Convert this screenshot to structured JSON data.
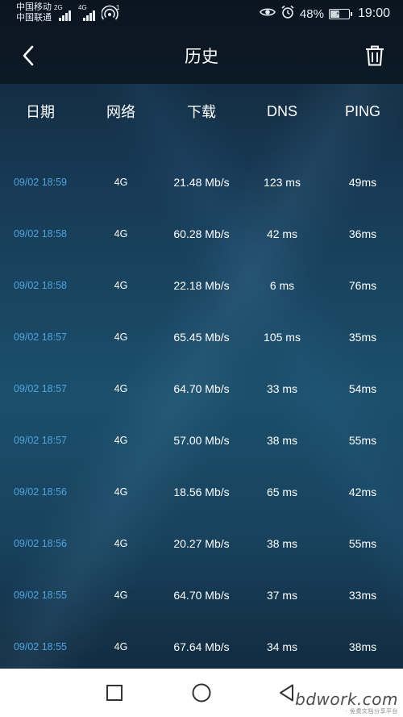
{
  "status_bar": {
    "carrier_1": "中国移动",
    "carrier_2": "中国联通",
    "network_1": "2G",
    "network_2": "4G",
    "hotspot_count": "1",
    "battery": "48%",
    "battery_level": 0.48,
    "time": "19:00",
    "icons": [
      "eye-icon",
      "alarm-icon",
      "battery-icon",
      "wifi-hotspot-icon",
      "signal-icon"
    ]
  },
  "app_bar": {
    "title": "历史",
    "back_icon": "chevron-left-icon",
    "delete_icon": "trash-icon"
  },
  "table": {
    "headers": [
      "日期",
      "网络",
      "下载",
      "DNS",
      "PING"
    ],
    "rows": [
      [
        "09/02 18:59",
        "4G",
        "21.48 Mb/s",
        "123 ms",
        "49ms"
      ],
      [
        "09/02 18:58",
        "4G",
        "60.28 Mb/s",
        "42 ms",
        "36ms"
      ],
      [
        "09/02 18:58",
        "4G",
        "22.18 Mb/s",
        "6 ms",
        "76ms"
      ],
      [
        "09/02 18:57",
        "4G",
        "65.45 Mb/s",
        "105 ms",
        "35ms"
      ],
      [
        "09/02 18:57",
        "4G",
        "64.70 Mb/s",
        "33 ms",
        "54ms"
      ],
      [
        "09/02 18:57",
        "4G",
        "57.00 Mb/s",
        "38 ms",
        "55ms"
      ],
      [
        "09/02 18:56",
        "4G",
        "18.56 Mb/s",
        "65 ms",
        "42ms"
      ],
      [
        "09/02 18:56",
        "4G",
        "20.27 Mb/s",
        "38 ms",
        "55ms"
      ],
      [
        "09/02 18:55",
        "4G",
        "64.70 Mb/s",
        "37 ms",
        "33ms"
      ],
      [
        "09/02 18:55",
        "4G",
        "67.64 Mb/s",
        "34 ms",
        "38ms"
      ]
    ]
  },
  "nav_bar": {
    "icons": [
      "recent-apps-icon",
      "home-icon",
      "back-triangle-icon"
    ]
  },
  "watermark": {
    "text": "bdwork.com",
    "sub": "· 免费文档分享平台"
  },
  "colors": {
    "date_text": "#4ea4e0",
    "header_bg": "#0c1a27",
    "nav_bg": "#ffffff"
  }
}
